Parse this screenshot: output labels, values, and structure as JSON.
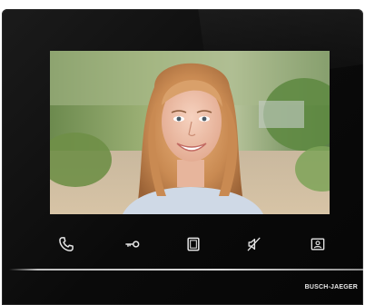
{
  "device": {
    "brand": "BUSCH-JAEGER",
    "colors": {
      "body": "#0a0a0a",
      "icon_glow": "#e6e6e6",
      "divider": "#d8d8d8"
    }
  },
  "screen": {
    "content": "video-feed"
  },
  "buttons": [
    {
      "name": "call-button",
      "icon": "phone-icon"
    },
    {
      "name": "door-open-button",
      "icon": "key-icon"
    },
    {
      "name": "light-button",
      "icon": "square-icon"
    },
    {
      "name": "mute-button",
      "icon": "muted-speaker-icon"
    },
    {
      "name": "contacts-button",
      "icon": "person-card-icon"
    }
  ]
}
